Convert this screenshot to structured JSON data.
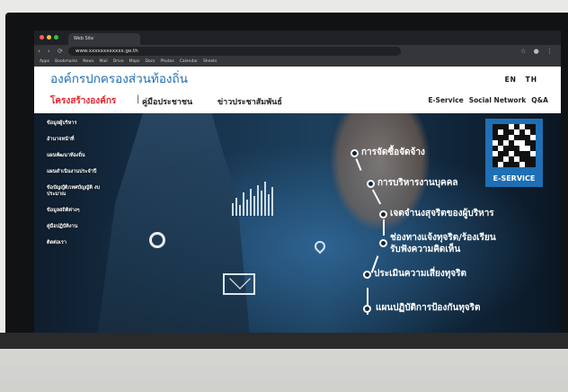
{
  "browser": {
    "tab_title": "Web Site",
    "url": "www.xxxxxxxxxxxx.go.th",
    "traffic_lights": [
      "#ff5f57",
      "#febc2e",
      "#28c840"
    ],
    "bookmarks": [
      "Apps",
      "Bookmarks",
      "News",
      "Mail",
      "Drive",
      "Maps",
      "Docs",
      "Photos",
      "Calendar",
      "Sheets"
    ]
  },
  "site": {
    "title": "องค์กรปกครองส่วนท้องถิ่น",
    "lang_en": "EN",
    "lang_th": "TH",
    "nav": {
      "structure": "โครงสร้างองค์กร",
      "separator": "|",
      "manual": "คู่มือประชาชน",
      "news": "ข่าวประชาสัมพันธ์",
      "eservice": "E-Service",
      "social": "Social Network",
      "qa": "Q&A"
    },
    "sidebar": [
      "ข้อมูลผู้บริหาร",
      "อำนาจหน้าที่",
      "แผนพัฒนาท้องถิ่น",
      "แผนดำเนินงานประจำปี",
      "ข้อบัญญัติ/เทศบัญญัติ งบประมาณ",
      "ข้อมูลสถิติต่างๆ",
      "คู่มือปฏิบัติงาน",
      "ติดต่อเรา"
    ],
    "services": [
      "การจัดซื้อจัดจ้าง",
      "การบริหารงานบุคคล",
      "เจตจำนงสุจริตของผู้บริหาร",
      "ช่องทางแจ้งทุจริต/ร้องเรียน",
      "รับฟังความคิดเห็น",
      "ประเมินความเสี่ยงทุจริต",
      "แผนปฏิบัติการป้องกันทุจริต"
    ],
    "qr_label": "E-SERVICE",
    "colors": {
      "brand_blue": "#1e6fb5",
      "nav_red": "#e2262a"
    }
  }
}
